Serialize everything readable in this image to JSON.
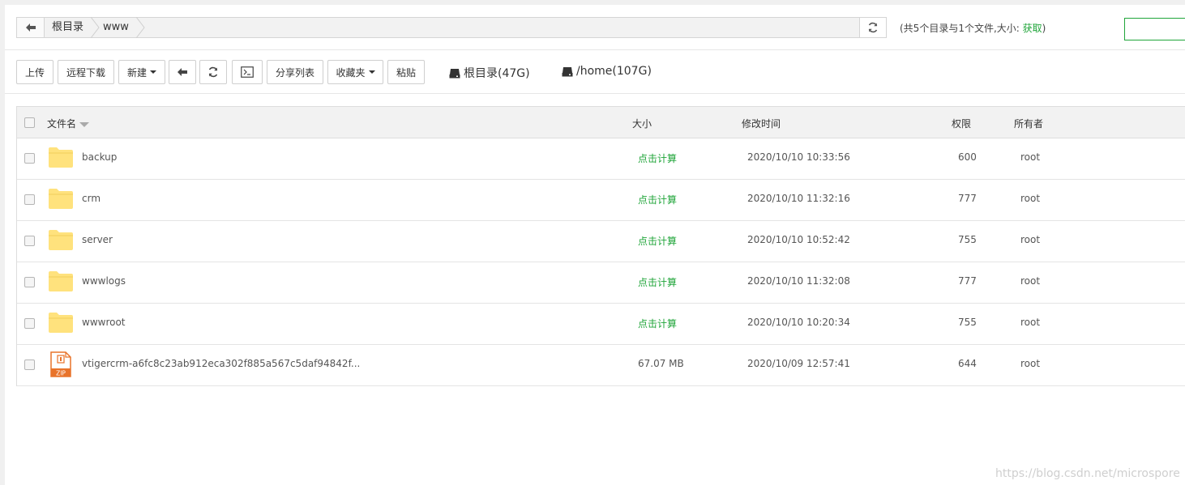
{
  "addressBar": {
    "breadcrumbs": [
      "根目录",
      "www"
    ],
    "info_prefix": "(共5个目录与1个文件,大小:",
    "info_fetch": "获取",
    "info_suffix": ")"
  },
  "toolbar": {
    "upload": "上传",
    "remote_download": "远程下载",
    "new": "新建",
    "share_list": "分享列表",
    "favorites": "收藏夹",
    "paste": "粘贴"
  },
  "disks": [
    {
      "label": "根目录(47G)"
    },
    {
      "label": "/home(107G)"
    }
  ],
  "table": {
    "headers": {
      "name": "文件名",
      "size": "大小",
      "mtime": "修改时间",
      "perm": "权限",
      "owner": "所有者"
    },
    "rows": [
      {
        "type": "folder",
        "name": "backup",
        "size": "点击计算",
        "mtime": "2020/10/10 10:33:56",
        "perm": "600",
        "owner": "root"
      },
      {
        "type": "folder",
        "name": "crm",
        "size": "点击计算",
        "mtime": "2020/10/10 11:32:16",
        "perm": "777",
        "owner": "root"
      },
      {
        "type": "folder",
        "name": "server",
        "size": "点击计算",
        "mtime": "2020/10/10 10:52:42",
        "perm": "755",
        "owner": "root"
      },
      {
        "type": "folder",
        "name": "wwwlogs",
        "size": "点击计算",
        "mtime": "2020/10/10 11:32:08",
        "perm": "777",
        "owner": "root"
      },
      {
        "type": "folder",
        "name": "wwwroot",
        "size": "点击计算",
        "mtime": "2020/10/10 10:20:34",
        "perm": "755",
        "owner": "root"
      },
      {
        "type": "zip",
        "name": "vtigercrm-a6fc8c23ab912eca302f885a567c5daf94842f...",
        "size": "67.07 MB",
        "mtime": "2020/10/09 12:57:41",
        "perm": "644",
        "owner": "root",
        "icon_text": "ZIP"
      }
    ]
  },
  "watermark": "https://blog.csdn.net/microspore",
  "colors": {
    "accent": "#20a53a",
    "folder": "#ffe27d",
    "zip": "#e8732a"
  }
}
